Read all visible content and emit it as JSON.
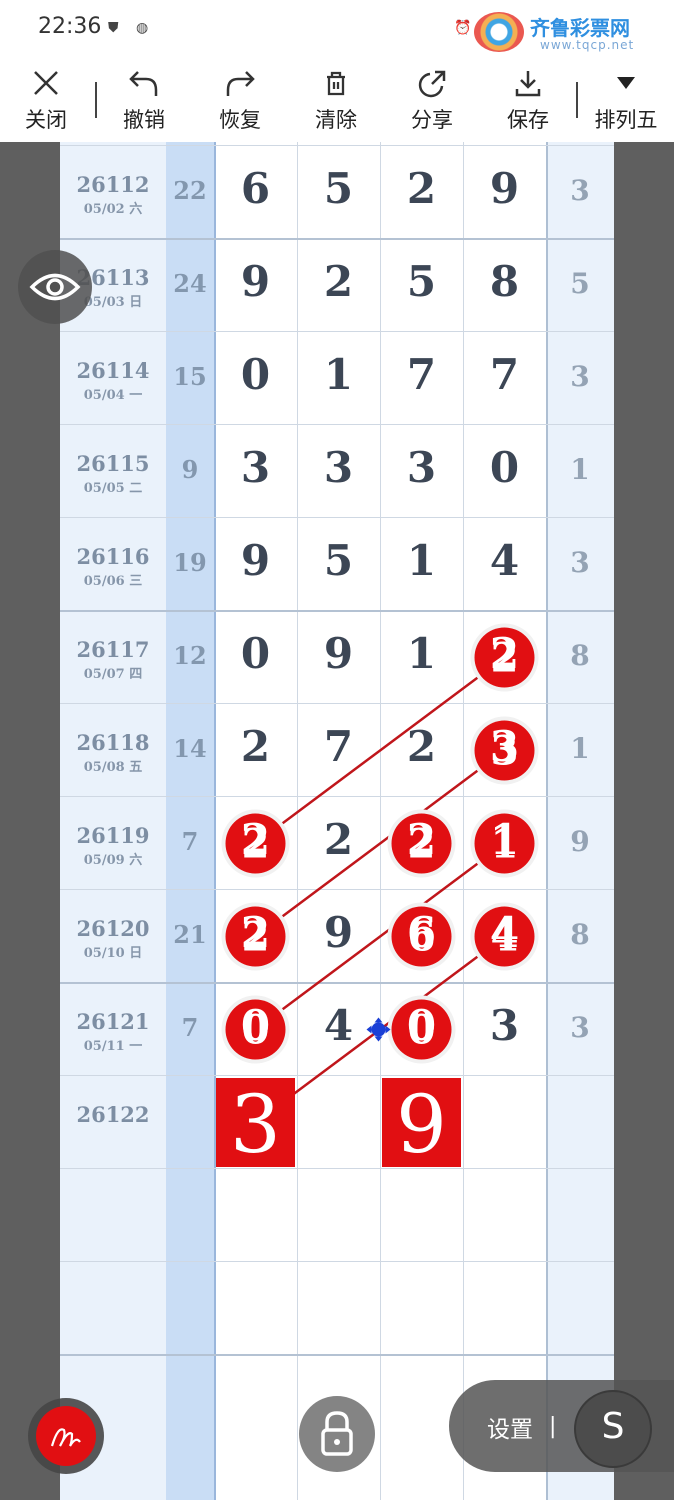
{
  "status_bar": {
    "time": "22:36"
  },
  "watermark": {
    "name": "齐鲁彩票网",
    "url": "www.tqcp.net"
  },
  "toolbar": {
    "close": "关闭",
    "undo": "撤销",
    "redo": "恢复",
    "clear": "清除",
    "share": "分享",
    "save": "保存",
    "mode": "排列五"
  },
  "rows": [
    {
      "issue": "26112",
      "date": "05/02 六",
      "sum": "22",
      "digits": [
        "6",
        "5",
        "2",
        "9"
      ],
      "last": "3"
    },
    {
      "issue": "26113",
      "date": "05/03 日",
      "sum": "24",
      "digits": [
        "9",
        "2",
        "5",
        "8"
      ],
      "last": "5"
    },
    {
      "issue": "26114",
      "date": "05/04 一",
      "sum": "15",
      "digits": [
        "0",
        "1",
        "7",
        "7"
      ],
      "last": "3"
    },
    {
      "issue": "26115",
      "date": "05/05 二",
      "sum": "9",
      "digits": [
        "3",
        "3",
        "3",
        "0"
      ],
      "last": "1"
    },
    {
      "issue": "26116",
      "date": "05/06 三",
      "sum": "19",
      "digits": [
        "9",
        "5",
        "1",
        "4"
      ],
      "last": "3"
    },
    {
      "issue": "26117",
      "date": "05/07 四",
      "sum": "12",
      "digits": [
        "0",
        "9",
        "1",
        "2"
      ],
      "last": "8"
    },
    {
      "issue": "26118",
      "date": "05/08 五",
      "sum": "14",
      "digits": [
        "2",
        "7",
        "2",
        "3"
      ],
      "last": "1"
    },
    {
      "issue": "26119",
      "date": "05/09 六",
      "sum": "7",
      "digits": [
        "2",
        "2",
        "2",
        "1"
      ],
      "last": "9"
    },
    {
      "issue": "26120",
      "date": "05/10 日",
      "sum": "21",
      "digits": [
        "2",
        "9",
        "6",
        "4"
      ],
      "last": "8"
    },
    {
      "issue": "26121",
      "date": "05/11 一",
      "sum": "7",
      "digits": [
        "0",
        "4",
        "0",
        "3"
      ],
      "last": "3"
    },
    {
      "issue": "26122",
      "date": "",
      "sum": "",
      "digits": [
        "",
        "",
        "",
        ""
      ],
      "last": ""
    }
  ],
  "marked_circles": [
    {
      "row": 5,
      "col": 3
    },
    {
      "row": 6,
      "col": 3
    },
    {
      "row": 7,
      "col": 0
    },
    {
      "row": 7,
      "col": 2
    },
    {
      "row": 7,
      "col": 3
    },
    {
      "row": 8,
      "col": 0
    },
    {
      "row": 8,
      "col": 2
    },
    {
      "row": 8,
      "col": 3
    },
    {
      "row": 9,
      "col": 0
    },
    {
      "row": 9,
      "col": 2
    }
  ],
  "predictions": [
    {
      "col": 0,
      "value": "3"
    },
    {
      "col": 2,
      "value": "9"
    }
  ],
  "trend_lines": [
    [
      {
        "row": 5,
        "col": 3
      },
      {
        "row": 7,
        "col": 0
      }
    ],
    [
      {
        "row": 6,
        "col": 3
      },
      {
        "row": 8,
        "col": 0
      }
    ],
    [
      {
        "row": 7,
        "col": 3
      },
      {
        "row": 9,
        "col": 0
      }
    ],
    [
      {
        "row": 8,
        "col": 3
      },
      {
        "row": 10,
        "col": 0
      }
    ]
  ],
  "settings": {
    "label": "设置",
    "separator": "|",
    "s_glyph": "S"
  },
  "colors": {
    "accent_red": "#e10f12",
    "sum_column": "#c9ddf5",
    "issue_column": "#eaf2fb"
  }
}
